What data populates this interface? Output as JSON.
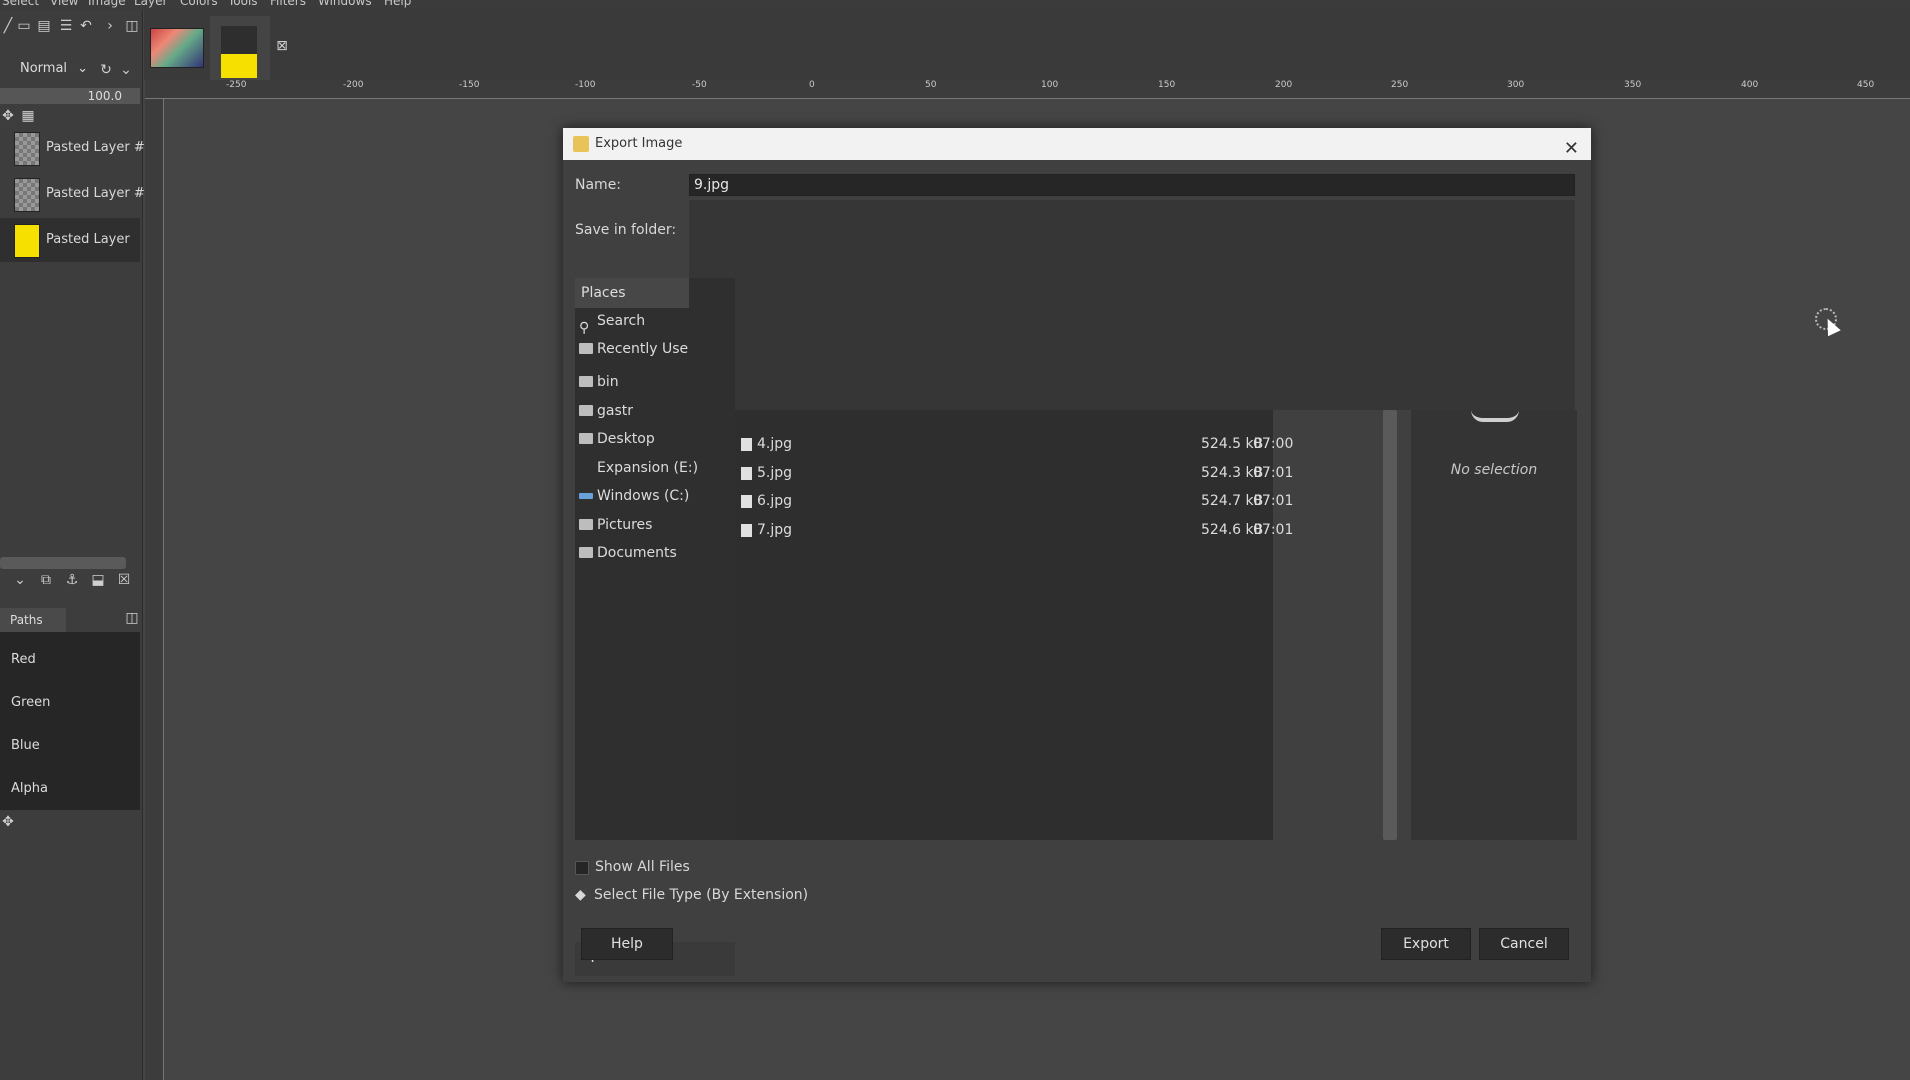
{
  "menubar": {
    "items": [
      "Select",
      "View",
      "Image",
      "Layer",
      "Colors",
      "Tools",
      "Filters",
      "Windows",
      "Help"
    ]
  },
  "layers_panel": {
    "mode": "Normal",
    "opacity": "100.0",
    "layers": [
      {
        "name": "Pasted Layer #"
      },
      {
        "name": "Pasted Layer #"
      },
      {
        "name": "Pasted Layer"
      }
    ]
  },
  "channels_panel": {
    "tab_label": "Paths",
    "channels": [
      "Red",
      "Green",
      "Blue",
      "Alpha"
    ]
  },
  "ruler": {
    "ticks": [
      "-250",
      "-200",
      "-150",
      "-100",
      "-50",
      "0",
      "50",
      "100",
      "150",
      "200",
      "250",
      "300",
      "350",
      "400",
      "450"
    ]
  },
  "dialog": {
    "title": "Export Image",
    "name_label": "Name:",
    "name_value": "9.jpg",
    "save_in_folder_label": "Save in folder:",
    "places_header": "Places",
    "places": [
      {
        "label": "Search",
        "icon": "search-icon"
      },
      {
        "label": "Recently Use",
        "icon": "recent-icon"
      },
      {
        "label": "bin",
        "icon": "folder-icon"
      },
      {
        "label": "gastr",
        "icon": "folder-icon"
      },
      {
        "label": "Desktop",
        "icon": "folder-icon"
      },
      {
        "label": "Expansion (E:)",
        "icon": "drive-icon"
      },
      {
        "label": "Windows (C:)",
        "icon": "drive-icon"
      },
      {
        "label": "Pictures",
        "icon": "folder-icon"
      },
      {
        "label": "Documents",
        "icon": "folder-icon"
      }
    ],
    "files": [
      {
        "name": "4.jpg",
        "size": "524.5 kB",
        "time": "07:00"
      },
      {
        "name": "5.jpg",
        "size": "524.3 kB",
        "time": "07:01"
      },
      {
        "name": "6.jpg",
        "size": "524.7 kB",
        "time": "07:01"
      },
      {
        "name": "7.jpg",
        "size": "524.6 kB",
        "time": "07:01"
      }
    ],
    "preview_text": "No selection",
    "show_all_files": "Show All Files",
    "select_file_type": "Select File Type (By Extension)",
    "help_button": "Help",
    "export_button": "Export",
    "cancel_button": "Cancel"
  },
  "colors": {
    "accent_yellow": "#f5e000",
    "dialog_bg": "#404040",
    "titlebar_bg": "#f2f2f2"
  }
}
